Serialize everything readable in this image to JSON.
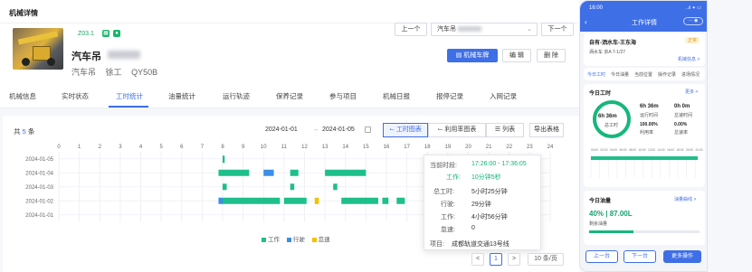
{
  "header": {
    "title": "机械详情"
  },
  "machine": {
    "code": "Z03.1",
    "name": "汽车吊",
    "type": "汽车吊",
    "operator": "徐工",
    "model": "QY50B"
  },
  "nav": {
    "prev": "上一个",
    "next": "下一个",
    "selector_value": "汽车吊",
    "machine_card_btn": "机械车牌",
    "edit": "编 辑",
    "delete": "删 除"
  },
  "tabs": [
    "机械信息",
    "实时状态",
    "工时统计",
    "油量统计",
    "运行轨迹",
    "保养记录",
    "参与项目",
    "机械日报",
    "报停记录",
    "入网记录"
  ],
  "toolbar": {
    "count_prefix": "共",
    "count": "5",
    "count_suffix": "条",
    "date_from": "2024-01-01",
    "date_arrow": "→",
    "date_to": "2024-01-05",
    "view_hours": "工时图表",
    "view_util": "利用率图表",
    "view_list": "列表",
    "export": "导出表格"
  },
  "chart_data": {
    "type": "timeline",
    "x_ticks": [
      "0",
      "1",
      "2",
      "3",
      "4",
      "5",
      "6",
      "7",
      "8",
      "9",
      "10",
      "11",
      "12",
      "13",
      "14",
      "15",
      "16",
      "17",
      "18",
      "19",
      "20",
      "21",
      "22",
      "23",
      "24"
    ],
    "rows": [
      "2024-01-05",
      "2024-01-04",
      "2024-01-03",
      "2024-01-02",
      "2024-01-01"
    ],
    "legend": [
      {
        "name": "工作",
        "color": "#1ebf8a"
      },
      {
        "name": "行驶",
        "color": "#3b8fe6"
      },
      {
        "name": "怠速",
        "color": "#f2c200"
      }
    ],
    "segments": [
      {
        "row": "2024-01-05",
        "start": 8.0,
        "end": 8.1,
        "kind": "工作"
      },
      {
        "row": "2024-01-04",
        "start": 7.8,
        "end": 9.3,
        "kind": "工作"
      },
      {
        "row": "2024-01-04",
        "start": 10.0,
        "end": 10.5,
        "kind": "行驶"
      },
      {
        "row": "2024-01-04",
        "start": 11.3,
        "end": 11.7,
        "kind": "工作"
      },
      {
        "row": "2024-01-04",
        "start": 13.0,
        "end": 15.0,
        "kind": "工作"
      },
      {
        "row": "2024-01-03",
        "start": 8.0,
        "end": 8.2,
        "kind": "工作"
      },
      {
        "row": "2024-01-03",
        "start": 11.3,
        "end": 11.5,
        "kind": "工作"
      },
      {
        "row": "2024-01-03",
        "start": 13.4,
        "end": 13.6,
        "kind": "工作"
      },
      {
        "row": "2024-01-02",
        "start": 7.8,
        "end": 8.0,
        "kind": "行驶"
      },
      {
        "row": "2024-01-02",
        "start": 8.0,
        "end": 10.8,
        "kind": "工作"
      },
      {
        "row": "2024-01-02",
        "start": 11.0,
        "end": 12.1,
        "kind": "工作"
      },
      {
        "row": "2024-01-02",
        "start": 12.5,
        "end": 12.7,
        "kind": "怠速"
      },
      {
        "row": "2024-01-02",
        "start": 13.8,
        "end": 15.6,
        "kind": "工作"
      },
      {
        "row": "2024-01-02",
        "start": 15.8,
        "end": 16.1,
        "kind": "工作"
      },
      {
        "row": "2024-01-02",
        "start": 16.5,
        "end": 16.9,
        "kind": "工作"
      }
    ]
  },
  "tooltip": {
    "time_label": "当前时段:",
    "time_value": "17:26:00 - 17:36:05",
    "work_label": "工作:",
    "work_value": "10分钟5秒",
    "total_label": "总工时:",
    "total_value": "5小时25分钟",
    "drive_label": "行驶:",
    "drive_value": "29分钟",
    "work2_label": "工作:",
    "work2_value": "4小时56分钟",
    "idle_label": "怠速:",
    "idle_value": "0",
    "project_label": "项目:",
    "project_value": "成都轨道交通13号线"
  },
  "pagination": {
    "page": "1",
    "page_size": "10 条/页",
    "prev": "<",
    "next": ">"
  },
  "phone": {
    "clock": "16:00",
    "status": "..ıl ✦ ▭",
    "title": "工作详情",
    "route": "自有-洒水车-王东海",
    "badge": "正常",
    "sub1": "洒水车 京A 7-1/27",
    "link": "机械信息 >",
    "tabs": [
      "今日工时",
      "今日油量",
      "当前位置",
      "操作记录",
      "进场情况"
    ],
    "hours_title": "今日工时",
    "more": "更多 >",
    "ring_value": "6h 36m",
    "ring_label": "总工时",
    "work_value": "6h 36m",
    "work_label": "运行时间",
    "idle_value": "0h 0m",
    "idle_label": "怠速时间",
    "pct1": "100.00%",
    "pct1_label": "利用率",
    "pct2": "0.00%",
    "pct2_label": "怠速率",
    "axis": [
      "00:00",
      "02:00",
      "04:00",
      "06:00",
      "08:00",
      "10:00",
      "12:00",
      "14:00",
      "16:00",
      "18:00",
      "20:00",
      "22:00"
    ],
    "fuel_title": "今日油量",
    "fuel_link": "油量曲线 >",
    "fuel_value": "40% | 87.00L",
    "fuel_sub": "剩余油量",
    "btn_prev": "上一台",
    "btn_next": "下一台",
    "btn_more": "更多操作"
  }
}
